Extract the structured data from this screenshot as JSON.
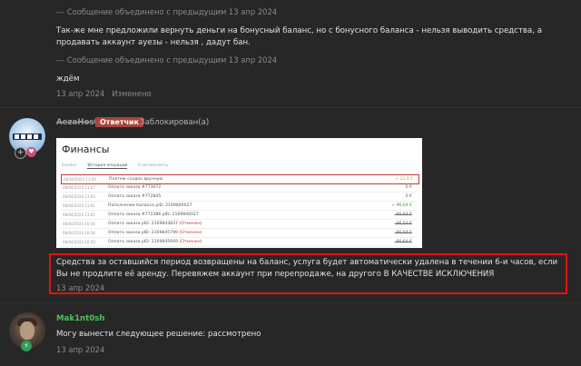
{
  "thread": {
    "post1": {
      "merged_note_1": "--- Сообщение объединено с предыдущим 13 апр 2024",
      "text_1": "Так-же мне предложили вернуть деньги на бонусный баланс, но с бонусного баланса - нельзя выводить средства, а продавать аккаунт ауезы - нельзя , дадут бан.",
      "merged_note_2": "--- Сообщение объединено с предыдущим 13 апр 2024",
      "text_2": "ждём",
      "date": "13 апр 2024",
      "edited": "Изменено"
    },
    "post2": {
      "username": "AezaHost",
      "role": "Ответчик",
      "status": "Заблокирован(а)",
      "screenshot": {
        "title": "Финансы",
        "tabs": [
          "Баланс",
          "История операций",
          "Счета/оплаты"
        ],
        "rows": [
          {
            "date": "08/04/2024 11:56",
            "desc": "Платеж создан вручную",
            "desc_red": "",
            "amount": "+ 23.4 €"
          },
          {
            "date": "08/04/2024 11:07",
            "desc": "Оплата заказа #773072",
            "desc_red": "",
            "amount": "0 €"
          },
          {
            "date": "08/04/2024 11:03",
            "desc": "Оплата заказа #772845",
            "desc_red": "",
            "amount": "0 €"
          },
          {
            "date": "08/04/2024 11:01",
            "desc": "Пополнение баланса pID: 2169846027",
            "desc_red": "",
            "amount": "+ 96,64 €"
          },
          {
            "date": "08/04/2024 11:01",
            "desc": "Оплата заказа #772386 pID: 2169846027",
            "desc_red": "",
            "amount": "-96,64 €"
          },
          {
            "date": "08/04/2024 10:56",
            "desc": "Оплата заказа pID: 2169843837",
            "desc_red": "(Отменен)",
            "amount": "-96,64 €"
          },
          {
            "date": "08/04/2024 10:54",
            "desc": "Оплата заказа pID: 2169845799",
            "desc_red": "(Отменен)",
            "amount": "-96,64 €"
          },
          {
            "date": "08/04/2024 10:50",
            "desc": "Оплата заказа pID: 2169845669",
            "desc_red": "(Отменен)",
            "amount": "-96,64 €"
          }
        ]
      },
      "text": "Средства за оставшийся период возвращены на баланс, услуга будет автоматически удалена в течении 6-и часов, если Вы не продлите её аренду. Перевяжем аккаунт при перепродаже, на другого В КАЧЕСТВЕ ИСКЛЮЧЕНИЯ",
      "date": "13 апр 2024"
    },
    "post3": {
      "username": "Mak1nt0sh",
      "text": "Могу вынести следующее решение: рассмотрено",
      "date": "13 апр 2024"
    }
  },
  "colors": {
    "background": "#272727",
    "role_badge": "#a8433e",
    "highlight_border": "#e01414",
    "username_green": "#4fc25a"
  }
}
